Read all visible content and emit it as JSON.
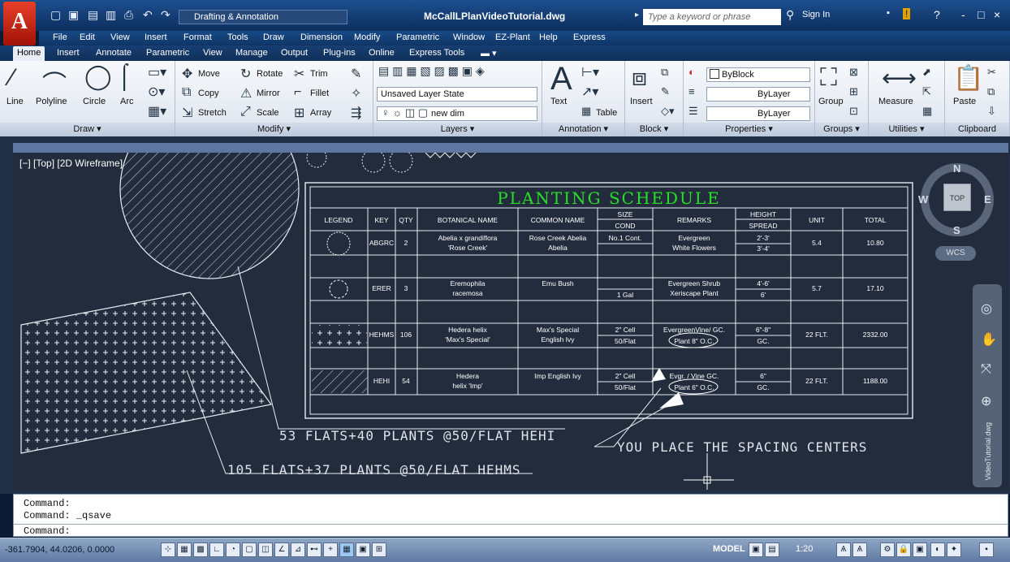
{
  "window": {
    "title": "McCallLPlanVideoTutorial.dwg",
    "app_letter": "A",
    "sign_in": "Sign In",
    "search_placeholder": "Type a keyword or phrase",
    "min": "-",
    "max": "□",
    "close": "×",
    "help": "?"
  },
  "workspace": "Drafting & Annotation",
  "menus": [
    "File",
    "Edit",
    "View",
    "Insert",
    "Format",
    "Tools",
    "Draw",
    "Dimension",
    "Modify",
    "Parametric",
    "Window",
    "EZ-Plant",
    "Help",
    "Express"
  ],
  "tabs": [
    "Home",
    "Insert",
    "Annotate",
    "Parametric",
    "View",
    "Manage",
    "Output",
    "Plug-ins",
    "Online",
    "Express Tools"
  ],
  "ribbon": {
    "draw": {
      "title": "Draw ▾",
      "line": "Line",
      "polyline": "Polyline",
      "circle": "Circle",
      "arc": "Arc"
    },
    "modify": {
      "title": "Modify ▾",
      "move": "Move",
      "rotate": "Rotate",
      "trim": "Trim",
      "copy": "Copy",
      "mirror": "Mirror",
      "fillet": "Fillet",
      "stretch": "Stretch",
      "scale": "Scale",
      "array": "Array"
    },
    "layers": {
      "title": "Layers ▾",
      "layer_state": "Unsaved Layer State",
      "current_layer": "new dim"
    },
    "annotation": {
      "title": "Annotation ▾",
      "text": "Text",
      "table": "Table"
    },
    "block": {
      "title": "Block ▾",
      "insert": "Insert"
    },
    "properties": {
      "title": "Properties ▾",
      "color": "ByBlock",
      "linetype": "ByLayer",
      "lineweight": "ByLayer"
    },
    "groups": {
      "title": "Groups ▾",
      "group": "Group"
    },
    "utilities": {
      "title": "Utilities ▾",
      "measure": "Measure"
    },
    "clipboard": {
      "title": "Clipboard",
      "paste": "Paste"
    }
  },
  "viewport": {
    "label": "[−] [Top] [2D Wireframe]",
    "cube_top": "TOP",
    "north": "N",
    "south": "S",
    "east": "E",
    "west": "W",
    "wcs": "WCS"
  },
  "schedule": {
    "title": "PLANTING SCHEDULE",
    "headers": [
      "LEGEND",
      "KEY",
      "QTY",
      "BOTANICAL NAME",
      "COMMON NAME",
      "SIZE",
      "COND",
      "REMARKS",
      "HEIGHT",
      "SPREAD",
      "UNIT",
      "TOTAL"
    ],
    "rows": [
      {
        "key": "ABGRC",
        "qty": "2",
        "bot1": "Abelia x grandiflora",
        "bot2": "'Rose Creek'",
        "com1": "Rose Creek Abelia",
        "com2": "Abelia",
        "size": "No.1 Cont.",
        "cond": "",
        "rem1": "Evergreen",
        "rem2": "White Flowers",
        "h": "2'-3'",
        "s": "3'-4'",
        "unit": "5.4",
        "total": "10.80"
      },
      {
        "key": "ERER",
        "qty": "3",
        "bot1": "Eremophila",
        "bot2": "racemosa",
        "com1": "Emu Bush",
        "com2": "",
        "size": "",
        "cond": "1 Gal",
        "rem1": "Evergreen Shrub",
        "rem2": "Xeriscape Plant",
        "h": "4'-6'",
        "s": "6'",
        "unit": "5.7",
        "total": "17.10"
      },
      {
        "key": "HEHMS",
        "qty": "106",
        "bot1": "Hedera helix",
        "bot2": "'Max's Special'",
        "com1": "Max's Special",
        "com2": "English Ivy",
        "size": "2\" Cell",
        "cond": "50/Flat",
        "rem1": "EvergreenVine/ GC.",
        "rem2": "Plant 8\" O.C.",
        "h": "6\"-8\"",
        "s": "GC.",
        "unit": "22 FLT.",
        "total": "2332.00"
      },
      {
        "key": "HEHI",
        "qty": "54",
        "bot1": "Hedera",
        "bot2": "helix 'Imp'",
        "com1": "Imp English Ivy",
        "com2": "",
        "size": "2\" Cell",
        "cond": "50/Flat",
        "rem1": "Evgr. / Vine GC.",
        "rem2": "Plant 6\" O.C.",
        "h": "6\"",
        "s": "GC.",
        "unit": "22 FLT.",
        "total": "1188.00"
      }
    ]
  },
  "annotations": {
    "hehi": "53 FLATS+40 PLANTS @50/FLAT HEHI",
    "hehms": "105 FLATS+37 PLANTS @50/FLAT HEHMS",
    "spacing": "YOU PLACE THE SPACING CENTERS"
  },
  "command": {
    "line1": "Command:",
    "line2": "Command:  _qsave",
    "prompt": "Command:"
  },
  "status": {
    "coords": "-361.7904, 44.0206, 0.0000",
    "model": "MODEL",
    "scale": "1:20"
  },
  "nav_label": "VideoTutorial.dwg"
}
